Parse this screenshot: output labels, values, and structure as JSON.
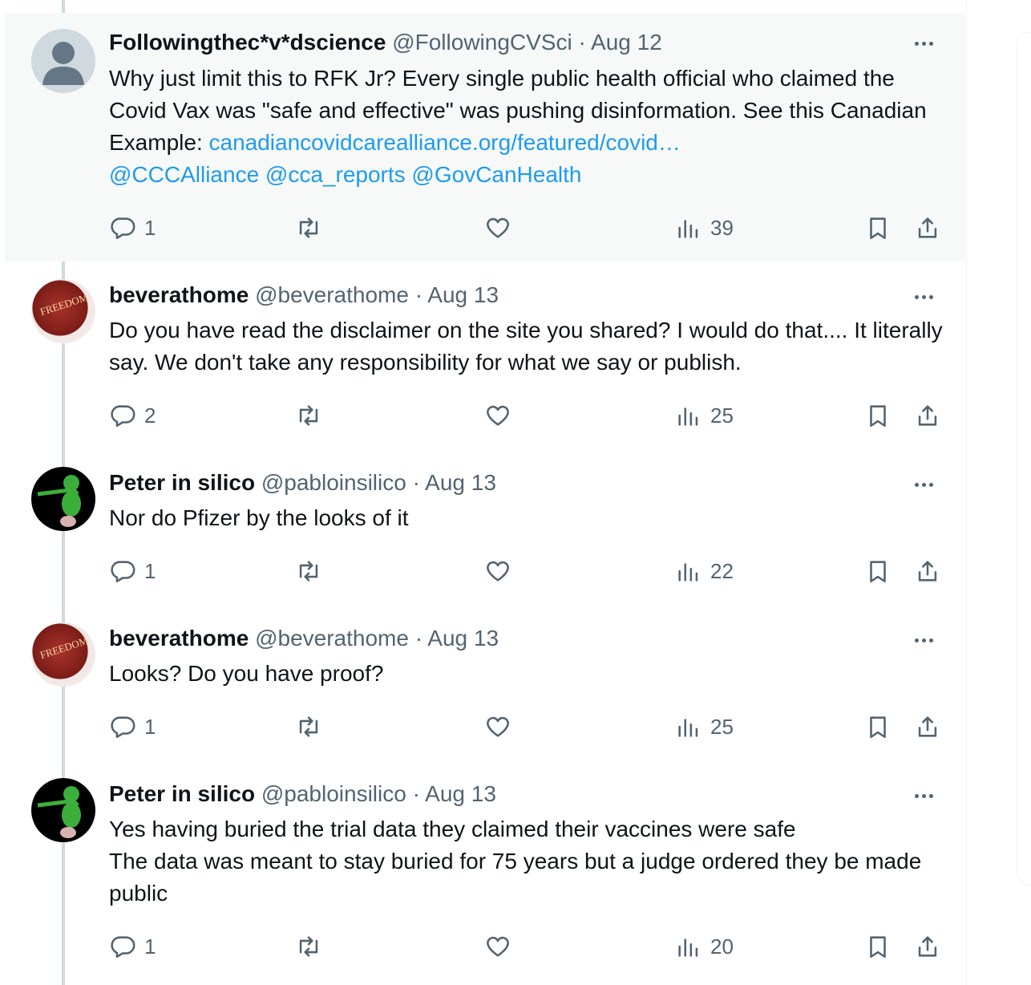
{
  "tweets": [
    {
      "name": "Followingthec*v*dscience",
      "handle": "@FollowingCVSci",
      "date": "Aug 12",
      "text": "Why just limit this to RFK Jr? Every single public health official who claimed the Covid Vax was \"safe and effective\" was pushing disinformation. See this Canadian Example: ",
      "link": "canadiancovidcarealliance.org/featured/covid…",
      "mentions": "@CCCAlliance @cca_reports @GovCanHealth",
      "replies": "1",
      "views": "39"
    },
    {
      "name": "beverathome",
      "handle": "@beverathome",
      "date": "Aug 13",
      "text": "Do you have read the disclaimer on the site you shared? I would do that.... It literally say. We don't take any responsibility for what we say or publish.",
      "replies": "2",
      "views": "25"
    },
    {
      "name": "Peter in silico",
      "handle": "@pabloinsilico",
      "date": "Aug 13",
      "text": "Nor do Pfizer by the looks of it",
      "replies": "1",
      "views": "22"
    },
    {
      "name": "beverathome",
      "handle": "@beverathome",
      "date": "Aug 13",
      "text": "Looks? Do you have proof?",
      "replies": "1",
      "views": "25"
    },
    {
      "name": "Peter in silico",
      "handle": "@pabloinsilico",
      "date": "Aug 13",
      "text": "Yes having buried the trial data they claimed their vaccines were safe\nThe data was meant to stay buried for 75 years but a judge ordered they be made public",
      "replies": "1",
      "views": "20"
    }
  ],
  "sep": "·",
  "avatar_book_text": "FREEDOM",
  "colors": {
    "link": "#1d9bf0",
    "muted": "#536471",
    "text": "#0f1419",
    "highlight_bg": "#f7f9f9"
  }
}
